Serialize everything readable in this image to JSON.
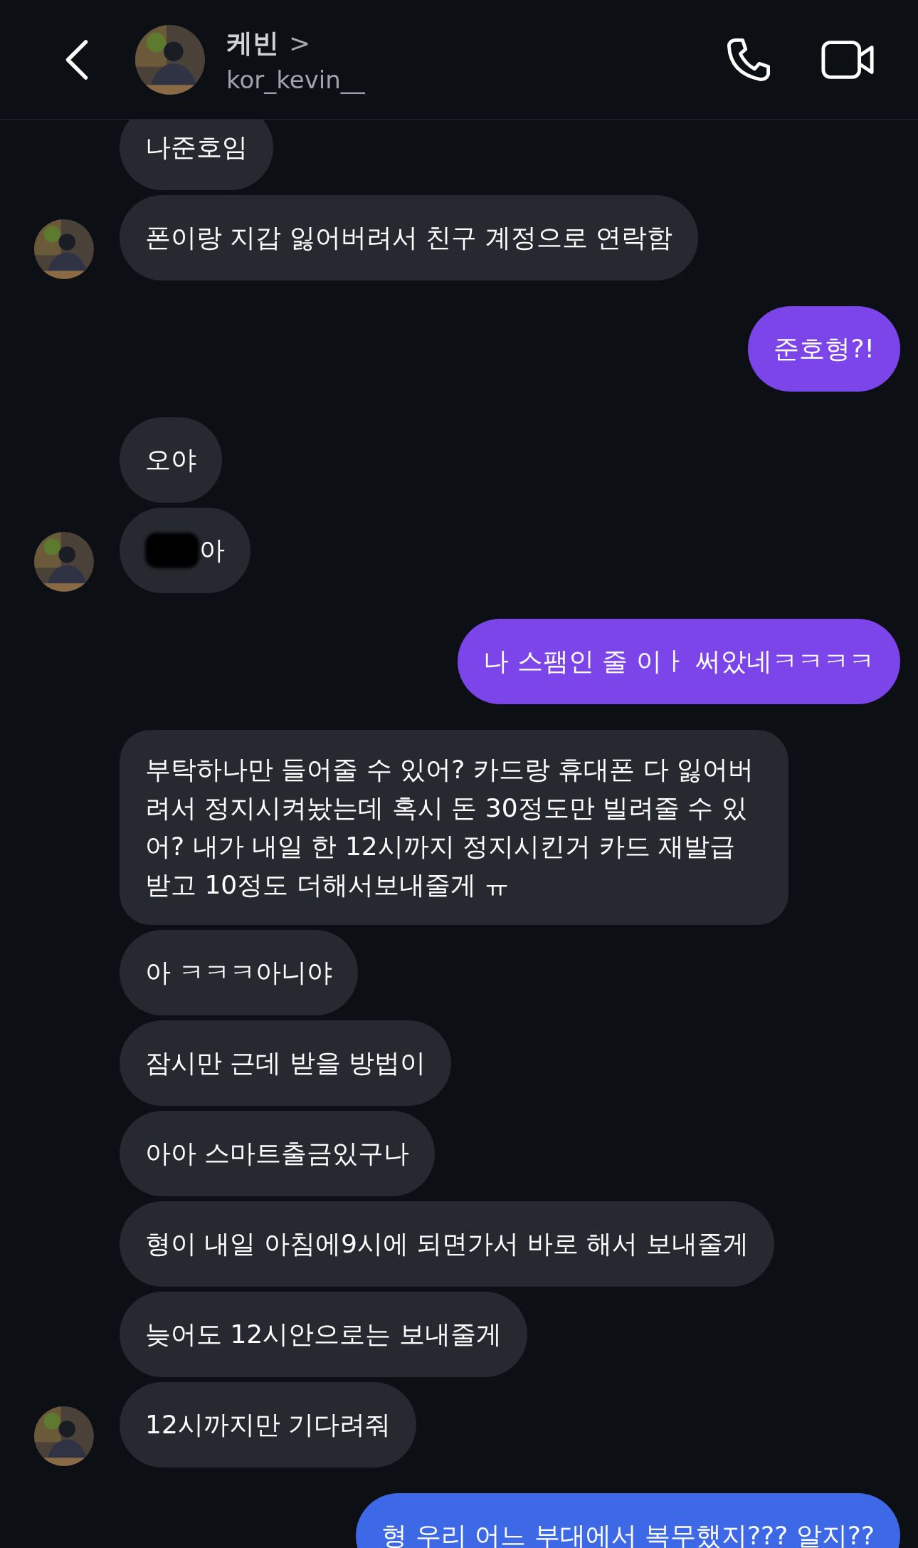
{
  "header": {
    "name": "케빈",
    "chevron": ">",
    "username": "kor_kevin__"
  },
  "messages": [
    {
      "kind": "received",
      "text": "나준호임",
      "avatar": false,
      "redacted": false
    },
    {
      "kind": "received",
      "text": "폰이랑 지갑 잃어버려서 친구 계정으로 연락함",
      "avatar": true,
      "redacted": false
    },
    {
      "kind": "sent",
      "text": "준호형?!",
      "color": "#7b45e9"
    },
    {
      "kind": "received",
      "text": "오야",
      "avatar": false,
      "redacted": false
    },
    {
      "kind": "received",
      "text": "아",
      "avatar": true,
      "redacted": true
    },
    {
      "kind": "sent",
      "text": "나 스팸인 줄 이ㅏ 써았네ㅋㅋㅋㅋ",
      "color": "#7b45e9"
    },
    {
      "kind": "received",
      "text": "부탁하나만 들어줄 수 있어? 카드랑 휴대폰 다 잃어버려서 정지시켜놨는데 혹시 돈 30정도만 빌려줄 수 있어? 내가 내일 한 12시까지 정지시킨거 카드 재발급 받고 10정도 더해서보내줄게 ㅠ",
      "avatar": false,
      "redacted": false
    },
    {
      "kind": "received",
      "text": "아 ㅋㅋㅋ아니야",
      "avatar": false,
      "redacted": false
    },
    {
      "kind": "received",
      "text": "잠시만 근데 받을 방법이",
      "avatar": false,
      "redacted": false
    },
    {
      "kind": "received",
      "text": "아아 스마트출금있구나",
      "avatar": false,
      "redacted": false
    },
    {
      "kind": "received",
      "text": "형이 내일 아침에9시에 되면가서 바로 해서 보내줄게",
      "avatar": false,
      "redacted": false
    },
    {
      "kind": "received",
      "text": "늦어도 12시안으로는 보내줄게",
      "avatar": false,
      "redacted": false
    },
    {
      "kind": "received",
      "text": "12시까지만 기다려줘",
      "avatar": true,
      "redacted": false
    },
    {
      "kind": "sent",
      "text": "형 우리 어느 부대에서 복무했지??? 알지??",
      "color": "#3d69e6"
    }
  ]
}
